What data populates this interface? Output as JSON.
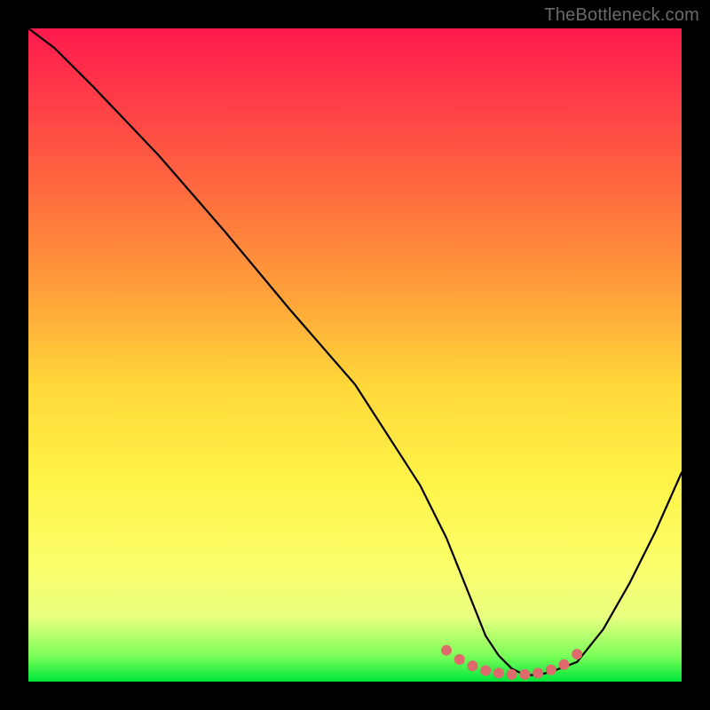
{
  "watermark": "TheBottleneck.com",
  "chart_data": {
    "type": "line",
    "title": "",
    "xlabel": "",
    "ylabel": "",
    "xlim": [
      0,
      100
    ],
    "ylim": [
      0,
      100
    ],
    "series": [
      {
        "name": "bottleneck-curve",
        "x": [
          0,
          4,
          10,
          20,
          30,
          40,
          50,
          60,
          64,
          66,
          68,
          70,
          72,
          74,
          76,
          78,
          80,
          84,
          88,
          92,
          96,
          100
        ],
        "values": [
          100,
          97,
          91,
          80.5,
          69,
          57,
          45.5,
          30,
          22,
          17,
          12,
          7,
          4,
          2,
          1,
          1,
          1.5,
          3,
          8,
          15,
          23,
          32
        ]
      }
    ],
    "markers": {
      "name": "highlight-dots",
      "color": "#dd6b6b",
      "x": [
        64,
        66,
        68,
        70,
        72,
        74,
        76,
        78,
        80,
        82,
        84
      ],
      "values": [
        4.8,
        3.4,
        2.4,
        1.7,
        1.3,
        1.1,
        1.1,
        1.3,
        1.8,
        2.6,
        4.2
      ]
    },
    "background_gradient": {
      "top": "#ff1a4d",
      "mid": "#fff44a",
      "bottom": "#00e63a"
    }
  }
}
